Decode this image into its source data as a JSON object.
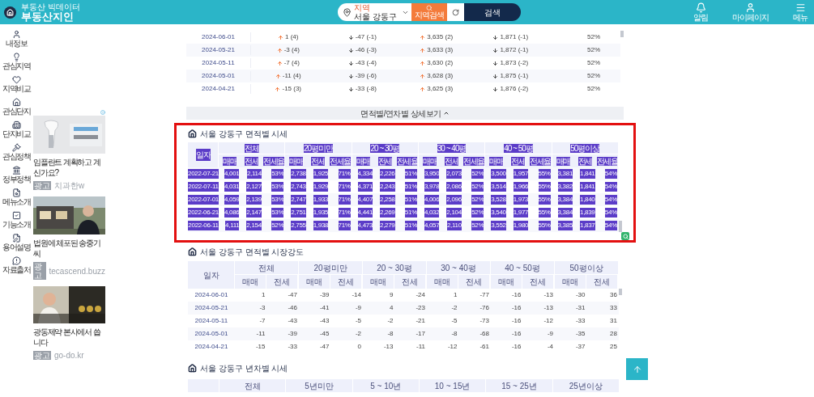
{
  "header": {
    "logo_small": "부동산 빅데이터",
    "logo": "부동산지인",
    "search": {
      "label": "지역",
      "value": "서울 강동구",
      "region_button": "지역검색",
      "submit": "검색"
    },
    "actions": [
      "알림",
      "마이페이지",
      "메뉴"
    ]
  },
  "sidebar": {
    "items": [
      "내 정보",
      "관심지역",
      "지역비교",
      "관심단지",
      "단지비교",
      "관심정책",
      "정부정책",
      "메뉴소개",
      "기능소개",
      "용어설명",
      "자료출처"
    ]
  },
  "ads": [
    {
      "title": "임플란트 계획하고 계신가요?",
      "badge": "광고",
      "source": "치과한w"
    },
    {
      "title": "법원에 체포된 송중기 씨",
      "badge": "광고",
      "source": "tecascend.buzz"
    },
    {
      "title": "광동제약 본사에서 씁니다",
      "badge": "광고",
      "source": "go-do.kr"
    }
  ],
  "trend_table": {
    "rows": [
      {
        "date": "2024-06-01",
        "cells": [
          {
            "kind": "up",
            "text": "1 (4)"
          },
          {
            "kind": "down",
            "text": "-47 (-1)"
          },
          {
            "kind": "up",
            "text": "3,635 (2)"
          },
          {
            "kind": "down",
            "text": "1,871 (-1)"
          }
        ],
        "ratio": "52%"
      },
      {
        "date": "2024-05-21",
        "cells": [
          {
            "kind": "up",
            "text": "-3 (4)"
          },
          {
            "kind": "down",
            "text": "-46 (-3)"
          },
          {
            "kind": "up",
            "text": "3,633 (3)"
          },
          {
            "kind": "down",
            "text": "1,872 (-1)"
          }
        ],
        "ratio": "52%"
      },
      {
        "date": "2024-05-11",
        "cells": [
          {
            "kind": "up",
            "text": "-7 (4)"
          },
          {
            "kind": "down",
            "text": "-43 (-4)"
          },
          {
            "kind": "up",
            "text": "3,630 (2)"
          },
          {
            "kind": "down",
            "text": "1,873 (-2)"
          }
        ],
        "ratio": "52%"
      },
      {
        "date": "2024-05-01",
        "cells": [
          {
            "kind": "up",
            "text": "-11 (4)"
          },
          {
            "kind": "down",
            "text": "-39 (-6)"
          },
          {
            "kind": "up",
            "text": "3,628 (3)"
          },
          {
            "kind": "down",
            "text": "1,875 (-1)"
          }
        ],
        "ratio": "52%"
      },
      {
        "date": "2024-04-21",
        "cells": [
          {
            "kind": "up",
            "text": "-15 (3)"
          },
          {
            "kind": "down",
            "text": "-33 (-8)"
          },
          {
            "kind": "up",
            "text": "3,625 (3)"
          },
          {
            "kind": "down",
            "text": "1,876 (-2)"
          }
        ],
        "ratio": "52%"
      }
    ],
    "more_button": "면적별/연차별 상세보기"
  },
  "price_section": {
    "title": "서울 강동구 면적별 시세",
    "highlighted": true,
    "text_selected": true,
    "date_header": "일자",
    "groups": [
      {
        "label": "전체",
        "subheaders": [
          "매매",
          "전세",
          "전세율"
        ]
      },
      {
        "label": "20평미만",
        "subheaders": [
          "매매",
          "전세",
          "전세율"
        ]
      },
      {
        "label": "20 ~ 30평",
        "subheaders": [
          "매매",
          "전세",
          "전세율"
        ]
      },
      {
        "label": "30 ~ 40평",
        "subheaders": [
          "매매",
          "전세",
          "전세율"
        ]
      },
      {
        "label": "40 ~ 50평",
        "subheaders": [
          "매매",
          "전세",
          "전세율"
        ]
      },
      {
        "label": "50평이상",
        "subheaders": [
          "매매",
          "전세",
          "전세율"
        ]
      }
    ],
    "rows": [
      {
        "date": "2022-07-21",
        "values": [
          "4,001",
          "2,114",
          "53%",
          "2,738",
          "1,925",
          "71%",
          "4,334",
          "2,226",
          "51%",
          "3,950",
          "2,073",
          "52%",
          "3,500",
          "1,957",
          "55%",
          "3,381",
          "1,841",
          "54%"
        ]
      },
      {
        "date": "2022-07-11",
        "values": [
          "4,031",
          "2,127",
          "53%",
          "2,743",
          "1,929",
          "71%",
          "4,371",
          "2,243",
          "51%",
          "3,978",
          "2,086",
          "52%",
          "3,514",
          "1,966",
          "55%",
          "3,382",
          "1,841",
          "54%"
        ]
      },
      {
        "date": "2022-07-01",
        "values": [
          "4,059",
          "2,139",
          "53%",
          "2,747",
          "1,933",
          "71%",
          "4,407",
          "2,258",
          "51%",
          "4,006",
          "2,096",
          "52%",
          "3,528",
          "1,973",
          "55%",
          "3,384",
          "1,840",
          "54%"
        ]
      },
      {
        "date": "2022-06-21",
        "values": [
          "4,086",
          "2,147",
          "53%",
          "2,751",
          "1,935",
          "71%",
          "4,441",
          "2,269",
          "51%",
          "4,032",
          "2,104",
          "52%",
          "3,540",
          "1,977",
          "55%",
          "3,384",
          "1,839",
          "54%"
        ]
      },
      {
        "date": "2022-06-11",
        "values": [
          "4,111",
          "2,154",
          "52%",
          "2,755",
          "1,938",
          "71%",
          "4,473",
          "2,279",
          "51%",
          "4,057",
          "2,110",
          "52%",
          "3,552",
          "1,980",
          "55%",
          "3,385",
          "1,837",
          "54%"
        ]
      }
    ]
  },
  "strength_section": {
    "title": "서울 강동구 면적별 시장강도",
    "date_header": "일자",
    "groups": [
      {
        "label": "전체",
        "subheaders": [
          "매매",
          "전세"
        ]
      },
      {
        "label": "20평미만",
        "subheaders": [
          "매매",
          "전세"
        ]
      },
      {
        "label": "20 ~ 30평",
        "subheaders": [
          "매매",
          "전세"
        ]
      },
      {
        "label": "30 ~ 40평",
        "subheaders": [
          "매매",
          "전세"
        ]
      },
      {
        "label": "40 ~ 50평",
        "subheaders": [
          "매매",
          "전세"
        ]
      },
      {
        "label": "50평이상",
        "subheaders": [
          "매매",
          "전세"
        ]
      }
    ],
    "rows": [
      {
        "date": "2024-06-01",
        "values": [
          "1",
          "-47",
          "-39",
          "-14",
          "9",
          "-24",
          "1",
          "-77",
          "-16",
          "-13",
          "-30",
          "36"
        ]
      },
      {
        "date": "2024-05-21",
        "values": [
          "-3",
          "-46",
          "-41",
          "-9",
          "4",
          "-23",
          "-2",
          "-76",
          "-16",
          "-13",
          "-31",
          "33"
        ]
      },
      {
        "date": "2024-05-11",
        "values": [
          "-7",
          "-43",
          "-43",
          "-5",
          "-2",
          "-21",
          "-5",
          "-73",
          "-16",
          "-12",
          "-33",
          "31"
        ]
      },
      {
        "date": "2024-05-01",
        "values": [
          "-11",
          "-39",
          "-45",
          "-2",
          "-8",
          "-17",
          "-8",
          "-68",
          "-16",
          "-9",
          "-35",
          "28"
        ]
      },
      {
        "date": "2024-04-21",
        "values": [
          "-15",
          "-33",
          "-47",
          "0",
          "-13",
          "-11",
          "-12",
          "-61",
          "-16",
          "-4",
          "-37",
          "25"
        ]
      }
    ]
  },
  "age_section": {
    "title": "서울 강동구 년차별 시세",
    "groups": [
      "전체",
      "5년미만",
      "5 ~ 10년",
      "10 ~ 15년",
      "15 ~ 25년",
      "25년이상"
    ]
  }
}
